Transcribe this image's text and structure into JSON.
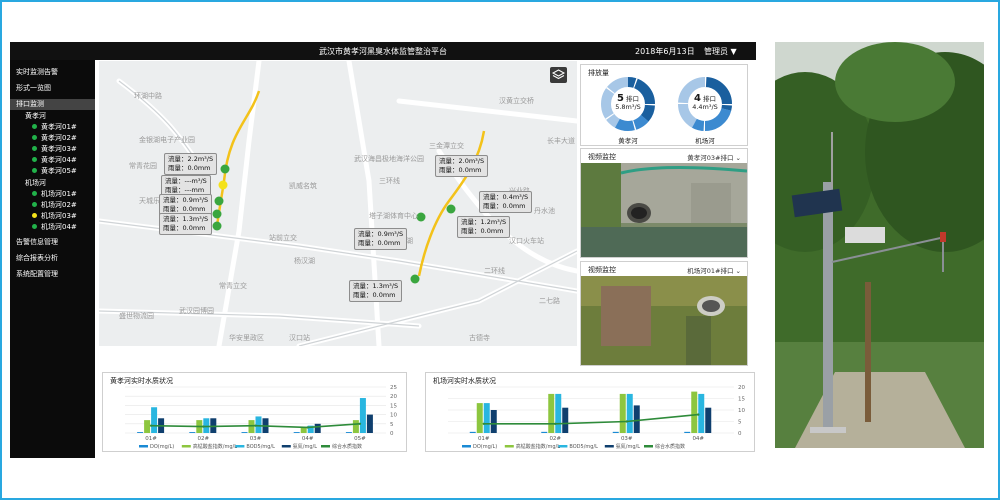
{
  "header": {
    "title": "武汉市黄孝河黑臭水体监管整治平台",
    "date": "2018年6月13日",
    "user": "管理员"
  },
  "sidebar": {
    "items": [
      {
        "label": "实时监测告警"
      },
      {
        "label": "形式一览图"
      },
      {
        "label": "排口监测"
      },
      {
        "label": "告警信息管理"
      },
      {
        "label": "综合报表分析"
      },
      {
        "label": "系统配置管理"
      }
    ],
    "groups": [
      {
        "label": "黄孝河",
        "stations": [
          {
            "label": "黄孝河01#",
            "status": "green"
          },
          {
            "label": "黄孝河02#",
            "status": "green"
          },
          {
            "label": "黄孝河03#",
            "status": "green"
          },
          {
            "label": "黄孝河04#",
            "status": "green"
          },
          {
            "label": "黄孝河05#",
            "status": "green"
          }
        ]
      },
      {
        "label": "机场河",
        "stations": [
          {
            "label": "机场河01#",
            "status": "green"
          },
          {
            "label": "机场河02#",
            "status": "green"
          },
          {
            "label": "机场河03#",
            "status": "yellow"
          },
          {
            "label": "机场河04#",
            "status": "green"
          }
        ]
      }
    ],
    "colors": {
      "green": "#21b24a",
      "yellow": "#f4e21b"
    }
  },
  "map": {
    "labels": [
      "环湖中路",
      "金银湖电子产业园",
      "常青花园",
      "凯威名筑",
      "武汉海昌极地海洋公园",
      "三金潭立交",
      "汉黄立交桥",
      "汉口火车站",
      "丹水池",
      "长丰大道",
      "站前立交",
      "二环线",
      "三环线",
      "常青立交",
      "盛世物流园",
      "武汉园博园",
      "华安里政区",
      "汉口站",
      "后湖",
      "古德寺",
      "塔子湖体育中心",
      "杨汉湖",
      "兴业路",
      "二七路",
      "天城乐花园"
    ],
    "callouts": [
      {
        "flow": "流量：2.2m³/S",
        "rain": "雨量：0.0mm"
      },
      {
        "flow": "流量：---m³/S",
        "rain": "雨量：---mm"
      },
      {
        "flow": "流量：0.9m³/S",
        "rain": "雨量：0.0mm"
      },
      {
        "flow": "流量：1.3m³/S",
        "rain": "雨量：0.0mm"
      },
      {
        "flow": "流量：2.0m³/S",
        "rain": "雨量：0.0mm"
      },
      {
        "flow": "流量：0.4m³/S",
        "rain": "雨量：0.0mm"
      },
      {
        "flow": "流量：1.2m³/S",
        "rain": "雨量：0.0mm"
      },
      {
        "flow": "流量：0.9m³/S",
        "rain": "雨量：0.0mm"
      },
      {
        "flow": "流量：1.3m³/S",
        "rain": "雨量：0.0mm"
      }
    ]
  },
  "discharge": {
    "title": "排放量",
    "rivers": [
      {
        "count": "5",
        "unit": "排口",
        "flow": "5.8m³/S",
        "label": "黄孝河"
      },
      {
        "count": "4",
        "unit": "排口",
        "flow": "4.4m³/S",
        "label": "机场河"
      }
    ]
  },
  "video": [
    {
      "title": "视频监控",
      "select": "黄孝河03#排口"
    },
    {
      "title": "视频监控",
      "select": "机场河01#排口"
    }
  ],
  "chart_data": [
    {
      "type": "bar",
      "title": "黄孝河实时水质状况",
      "categories": [
        "01#",
        "02#",
        "03#",
        "04#",
        "05#"
      ],
      "ylim": [
        0,
        25
      ],
      "yticks": [
        0,
        5,
        10,
        15,
        20,
        25
      ],
      "series": [
        {
          "name": "DO(mg/L)",
          "color": "#1a8ad4",
          "values": [
            0.5,
            0.5,
            0.5,
            0.5,
            0.5
          ]
        },
        {
          "name": "高锰酸盐指数/mg/L",
          "color": "#8dc63f",
          "values": [
            7,
            7,
            7,
            3,
            7
          ]
        },
        {
          "name": "BOD5/mg/L",
          "color": "#29b6e0",
          "values": [
            14,
            8,
            9,
            4,
            19
          ]
        },
        {
          "name": "氨氮/mg/L",
          "color": "#0f3f6e",
          "values": [
            8,
            8,
            8,
            5,
            10
          ]
        },
        {
          "name": "综合水质指数",
          "color": "#2e8b3a",
          "kind": "line",
          "values": [
            4,
            3.5,
            4,
            3,
            5
          ]
        }
      ]
    },
    {
      "type": "bar",
      "title": "机场河实时水质状况",
      "categories": [
        "01#",
        "02#",
        "03#",
        "04#"
      ],
      "ylim": [
        0,
        20
      ],
      "yticks": [
        0,
        5,
        10,
        15,
        20
      ],
      "series": [
        {
          "name": "DO(mg/L)",
          "color": "#1a8ad4",
          "values": [
            0.5,
            0.5,
            0.5,
            0.5
          ]
        },
        {
          "name": "高锰酸盐指数/mg/L",
          "color": "#8dc63f",
          "values": [
            13,
            17,
            17,
            18
          ]
        },
        {
          "name": "BOD5/mg/L",
          "color": "#29b6e0",
          "values": [
            13,
            17,
            17,
            17
          ]
        },
        {
          "name": "氨氮/mg/L",
          "color": "#0f3f6e",
          "values": [
            10,
            11,
            12,
            11
          ]
        },
        {
          "name": "综合水质指数",
          "color": "#2e8b3a",
          "kind": "line",
          "values": [
            4,
            4,
            5,
            8
          ]
        }
      ]
    }
  ]
}
